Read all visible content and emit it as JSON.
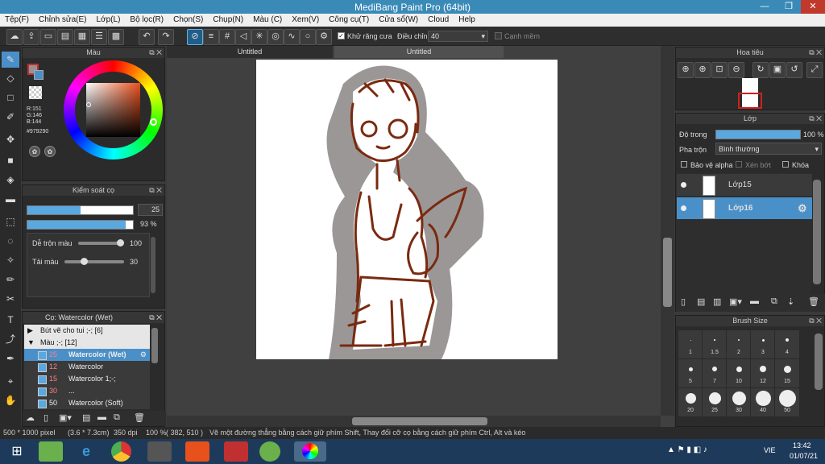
{
  "window": {
    "title": "MediBang Paint Pro (64bit)"
  },
  "menu": [
    "Tệp(F)",
    "Chỉnh sửa(E)",
    "Lớp(L)",
    "Bộ lọc(R)",
    "Chọn(S)",
    "Chụp(N)",
    "Màu (C)",
    "Xem(V)",
    "Công cụ(T)",
    "Cửa sổ(W)",
    "Cloud",
    "Help"
  ],
  "toolbar": {
    "antialias_label": "Khử răng cưa",
    "adjust_label": "Điều chỉnh",
    "adjust_value": "40",
    "smooth_label": "Cạnh mềm"
  },
  "color_panel": {
    "title": "Màu",
    "r": "R:151",
    "g": "G:146",
    "b": "B:144",
    "hex": "#979290",
    "fg_color": "#979290"
  },
  "brush_control": {
    "title": "Kiểm soát cọ",
    "size_value": "25",
    "opacity_value": "93 %",
    "blend_label": "Dễ trộn màu",
    "blend_value": "100",
    "amount_label": "Tải màu",
    "amount_value": "30",
    "size_fill": 0.5,
    "opacity_fill": 0.93
  },
  "brush_list": {
    "title": "Cọ: Watercolor (Wet)",
    "groups": [
      {
        "label": "Bút vẽ cho tui ;-; [6]"
      },
      {
        "label": "Màu ;-; [12]"
      }
    ],
    "items": [
      {
        "num": "25",
        "name": "Watercolor (Wet)"
      },
      {
        "num": "12",
        "name": "Watercolor"
      },
      {
        "num": "15",
        "name": "Watercolor 1;-;"
      },
      {
        "num": "30",
        "name": "..."
      },
      {
        "num": "50",
        "name": "Watercolor (Soft)"
      }
    ]
  },
  "tabs": [
    "Untitled",
    "Untitled"
  ],
  "navigator": {
    "title": "Hoa tiêu"
  },
  "layer_panel": {
    "title": "Lớp",
    "opacity_label": "Độ trong",
    "opacity_value": "100 %",
    "blend_label": "Pha trộn",
    "blend_value": "Bình thường",
    "protect_alpha_label": "Bảo vệ alpha",
    "clip_label": "Xén bớt",
    "lock_label": "Khóa",
    "layers": [
      {
        "name": "Lớp15"
      },
      {
        "name": "Lớp16"
      }
    ]
  },
  "brush_size": {
    "title": "Brush Size",
    "sizes": [
      "1",
      "1.5",
      "2",
      "3",
      "4",
      "5",
      "7",
      "10",
      "12",
      "15",
      "20",
      "25",
      "30",
      "40",
      "50"
    ]
  },
  "status": {
    "size": "500 * 1000 pixel",
    "dim": "(3.6 * 7.3cm)",
    "dpi": "350 dpi",
    "zoom": "100 %",
    "coord": "( 382, 510 )",
    "hint": "Vẽ một đường thẳng bằng cách giữ phím Shift, Thay đổi cỡ cọ bằng cách giữ phím Ctrl, Alt và kéo"
  },
  "taskbar": {
    "lang": "VIE",
    "time": "13:42",
    "date": "01/07/21"
  }
}
